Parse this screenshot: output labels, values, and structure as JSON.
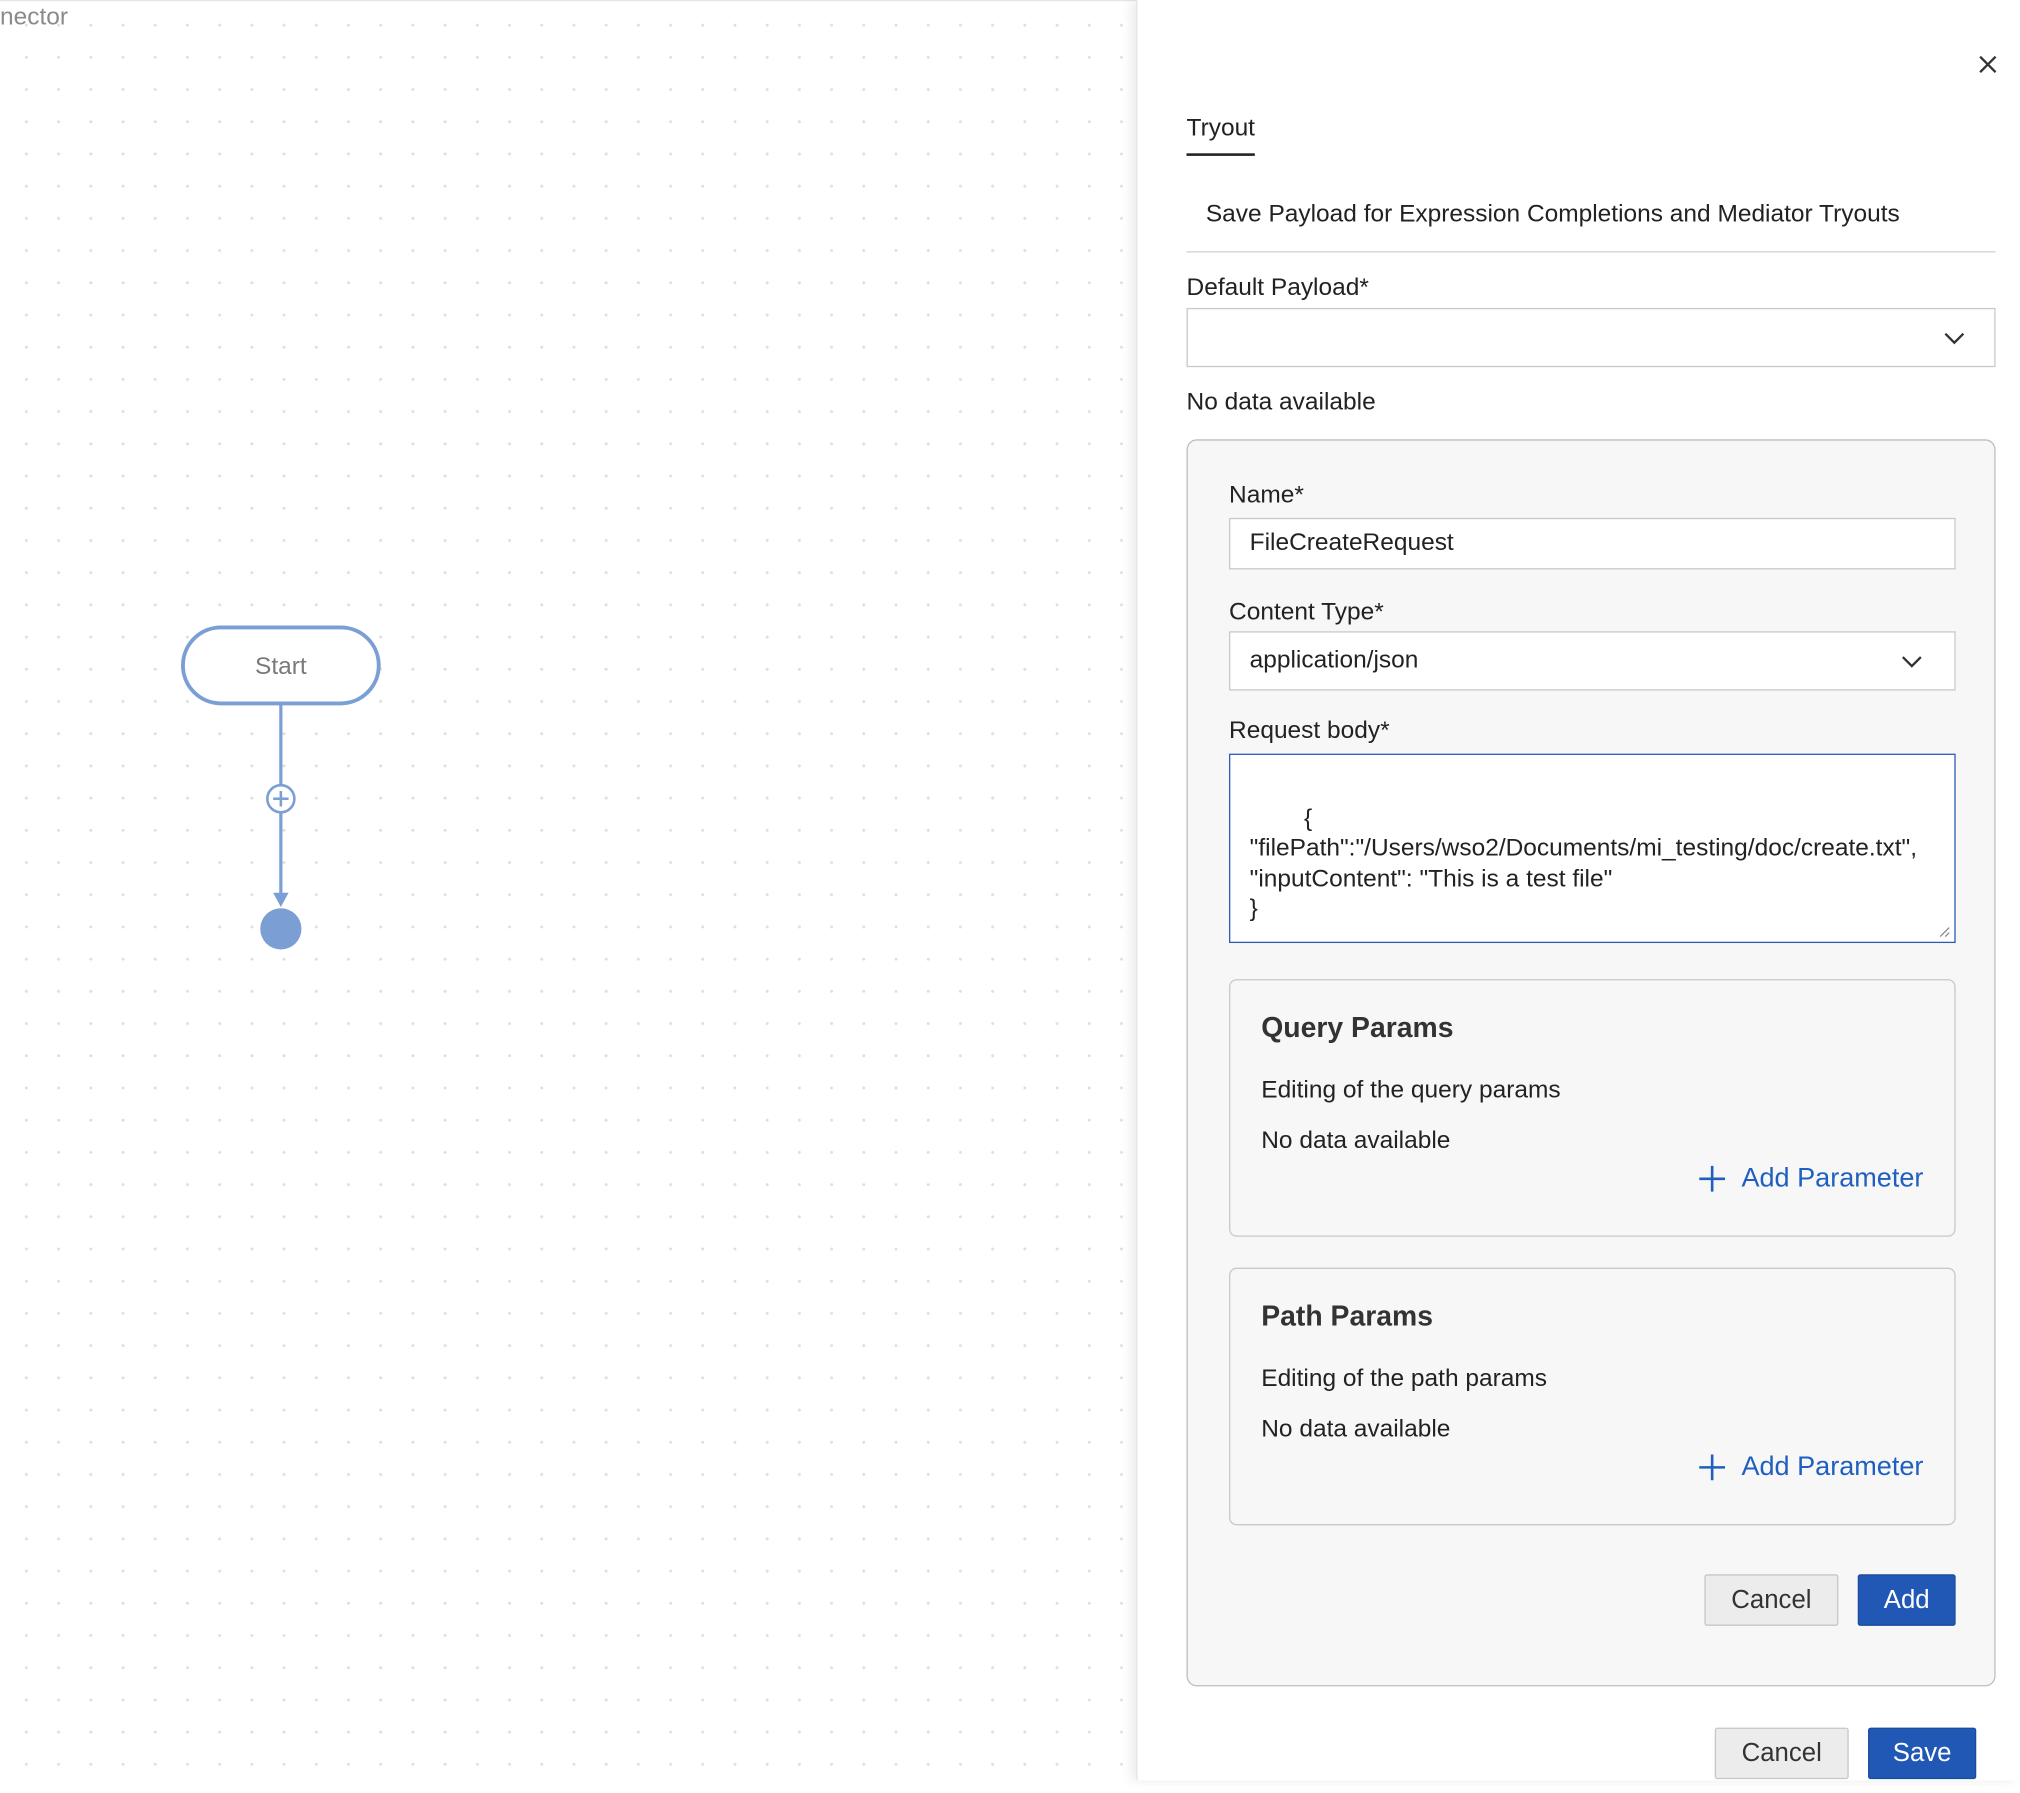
{
  "canvas": {
    "title_fragment": "nector",
    "start_node_label": "Start"
  },
  "panel": {
    "tab_label": "Tryout",
    "description": "Save Payload for Expression Completions and Mediator Tryouts",
    "default_payload": {
      "label": "Default Payload*",
      "value": ""
    },
    "no_data_text": "No data available",
    "form": {
      "name_label": "Name*",
      "name_value": "FileCreateRequest",
      "content_type_label": "Content Type*",
      "content_type_value": "application/json",
      "request_body_label": "Request body*",
      "request_body_value": "{\n\"filePath\":\"/Users/wso2/Documents/mi_testing/doc/create.txt\",\n\"inputContent\": \"This is a test file\"\n}",
      "query_params": {
        "title": "Query Params",
        "description": "Editing of the query params",
        "no_data": "No data available",
        "add_label": "Add Parameter"
      },
      "path_params": {
        "title": "Path Params",
        "description": "Editing of the path params",
        "no_data": "No data available",
        "add_label": "Add Parameter"
      },
      "cancel_label": "Cancel",
      "add_label": "Add"
    },
    "cancel_label": "Cancel",
    "save_label": "Save"
  },
  "colors": {
    "accent": "#2158b5",
    "link": "#1f5fbf",
    "flow": "#7b9fd4"
  },
  "icons": {
    "close": "close-icon",
    "dropdown": "chevron-down-icon",
    "add": "plus-icon",
    "add_node": "plus-circle-icon"
  }
}
